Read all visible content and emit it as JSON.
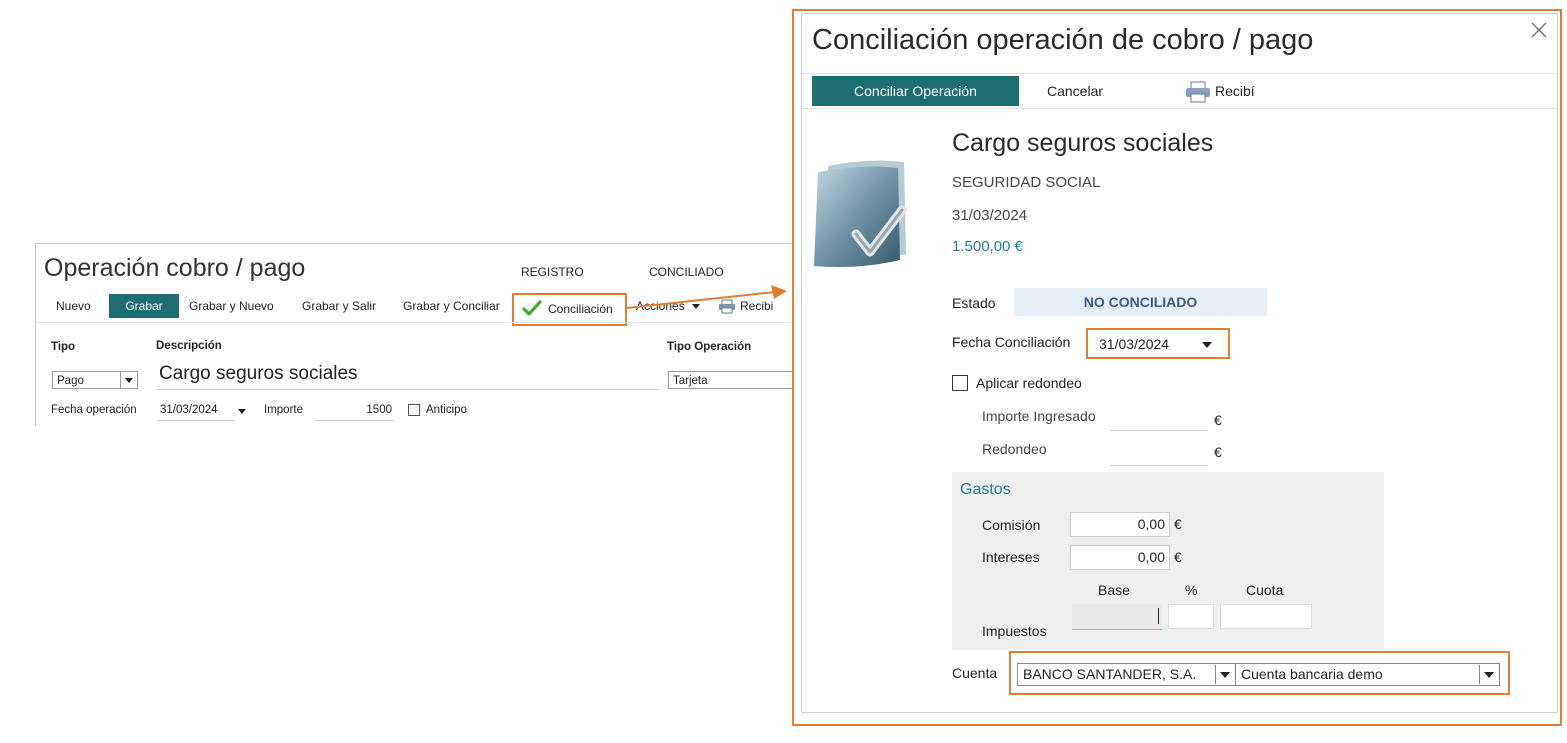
{
  "background_form": {
    "title": "Operación cobro / pago",
    "status_labels": [
      "REGISTRO",
      "CONCILIADO"
    ],
    "toolbar": {
      "nuevo": "Nuevo",
      "grabar": "Grabar",
      "grabar_nuevo": "Grabar y Nuevo",
      "grabar_salir": "Grabar y Salir",
      "grabar_conciliar": "Grabar y Conciliar",
      "conciliacion": "Conciliación",
      "acciones": "Acciones",
      "recibi": "Recibi"
    },
    "fields": {
      "tipo_label": "Tipo",
      "tipo_value": "Pago",
      "descripcion_label": "Descripción",
      "descripcion_value": "Cargo seguros sociales",
      "tipo_operacion_label": "Tipo Operación",
      "tipo_operacion_value": "Tarjeta",
      "fecha_operacion_label": "Fecha operación",
      "fecha_operacion_value": "31/03/2024",
      "importe_label": "Importe",
      "importe_value": "1500",
      "anticipo_label": "Anticipo"
    }
  },
  "modal": {
    "title": "Conciliación operación de cobro / pago",
    "toolbar": {
      "conciliar": "Conciliar Operación",
      "cancelar": "Cancelar",
      "recibi": "Recibí"
    },
    "summary": {
      "descripcion": "Cargo seguros sociales",
      "entidad": "SEGURIDAD SOCIAL",
      "fecha": "31/03/2024",
      "importe": "1.500,00 €"
    },
    "estado_label": "Estado",
    "estado_value": "NO CONCILIADO",
    "fecha_conciliacion_label": "Fecha Conciliación",
    "fecha_conciliacion_value": "31/03/2024",
    "aplicar_redondeo_label": "Aplicar redondeo",
    "importe_ingresado_label": "Importe Ingresado",
    "redondeo_label": "Redondeo",
    "currency": "€",
    "gastos": {
      "title": "Gastos",
      "comision_label": "Comisión",
      "comision_value": "0,00",
      "intereses_label": "Intereses",
      "intereses_value": "0,00",
      "col_base": "Base",
      "col_pct": "%",
      "col_cuota": "Cuota",
      "impuestos_label": "Impuestos"
    },
    "cuenta_label": "Cuenta",
    "cuenta_banco": "BANCO SANTANDER, S.A.",
    "cuenta_tipo": "Cuenta bancaria demo"
  },
  "colors": {
    "accent_teal": "#1c6e73",
    "highlight_orange": "#e07f32",
    "status_bg": "#e6eff8",
    "status_text": "#3b5a8a",
    "amount_text": "#1f7f8c"
  }
}
